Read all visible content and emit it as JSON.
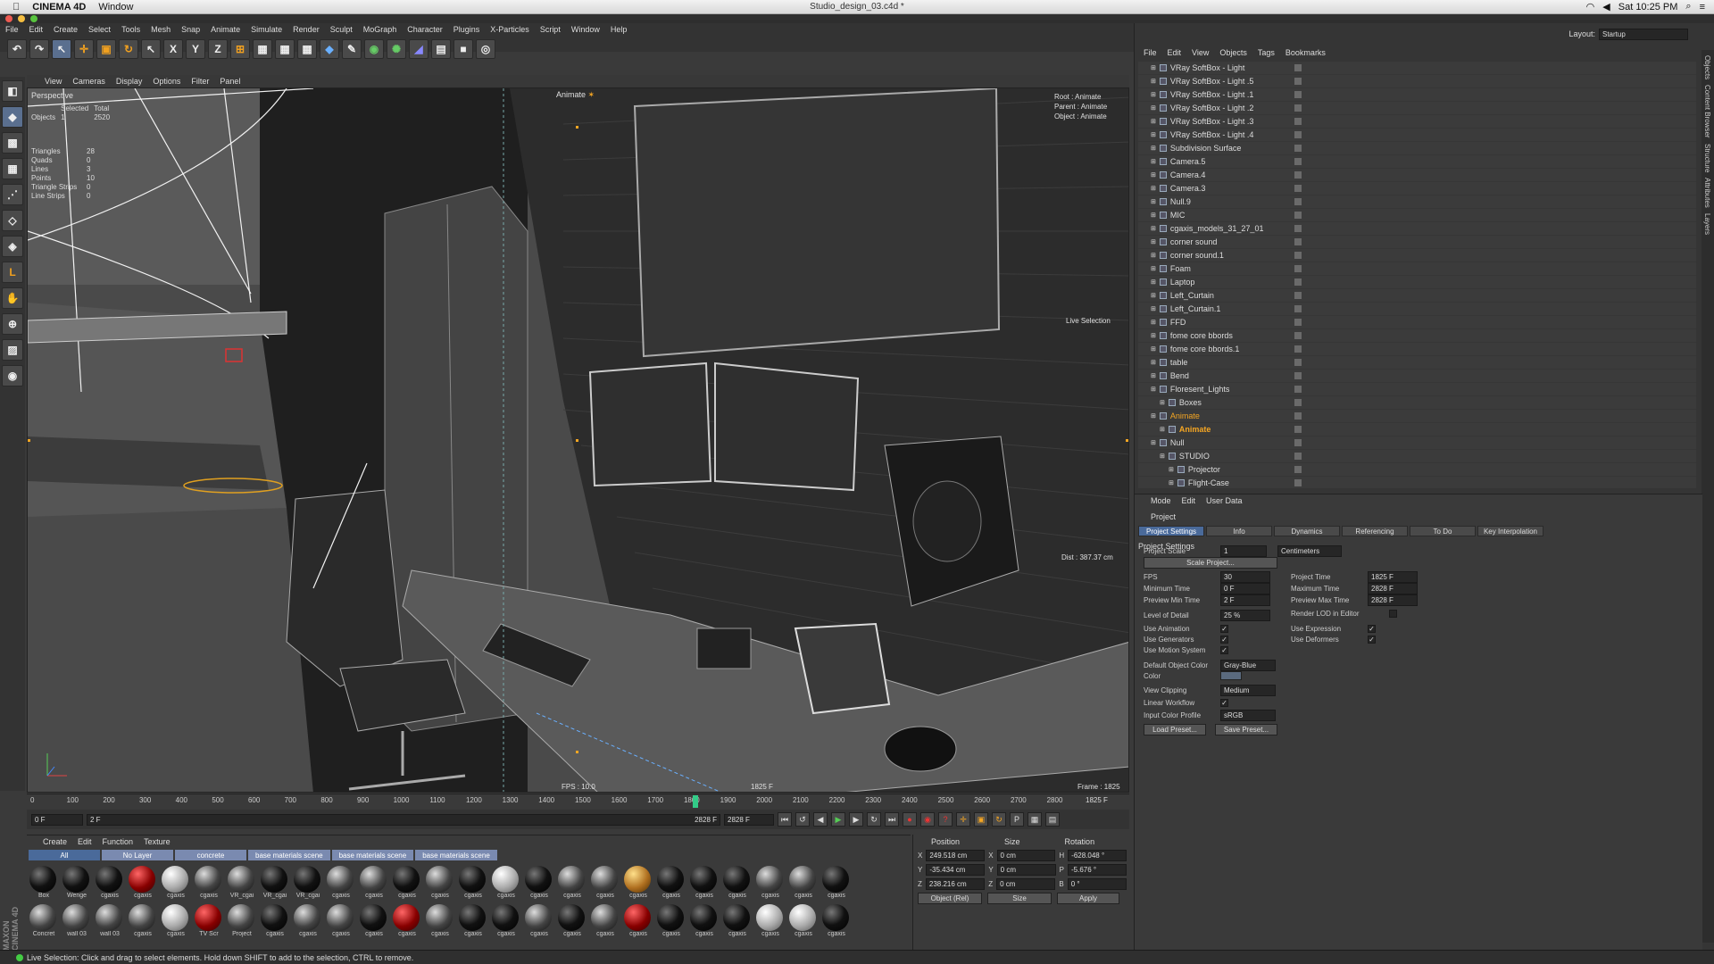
{
  "macbar": {
    "app": "CINEMA 4D",
    "menu": "Window",
    "title": "Studio_design_03.c4d *",
    "clock": "Sat 10:25 PM"
  },
  "menus": [
    "File",
    "Edit",
    "Create",
    "Select",
    "Tools",
    "Mesh",
    "Snap",
    "Animate",
    "Simulate",
    "Render",
    "Sculpt",
    "MoGraph",
    "Character",
    "Plugins",
    "X-Particles",
    "Script",
    "Window",
    "Help"
  ],
  "toolbar": {
    "x": "X",
    "y": "Y",
    "z": "Z"
  },
  "viewport": {
    "menus": [
      "View",
      "Cameras",
      "Display",
      "Options",
      "Filter",
      "Panel"
    ],
    "camera": "Perspective",
    "animate_label": "Animate",
    "stats_head": [
      "",
      "Selected",
      "Total"
    ],
    "stats_objects": [
      "Objects",
      "1",
      "2520"
    ],
    "stats": [
      [
        "Triangles",
        "28"
      ],
      [
        "Quads",
        "0"
      ],
      [
        "Lines",
        "3"
      ],
      [
        "Points",
        "10"
      ],
      [
        "Triangle Strips",
        "0"
      ],
      [
        "Line Strips",
        "0"
      ]
    ],
    "root": "Root : Animate",
    "parent": "Parent : Animate",
    "object": "Object : Animate",
    "live_selection": "Live Selection",
    "dist": "Dist : 387.37 cm",
    "fps": "FPS : 10.0",
    "frame_marker": "1825 F",
    "frame": "Frame : 1825"
  },
  "timeline": {
    "ticks": [
      "0",
      "100",
      "200",
      "300",
      "400",
      "500",
      "600",
      "700",
      "800",
      "900",
      "1000",
      "1100",
      "1200",
      "1300",
      "1400",
      "1500",
      "1600",
      "1700",
      "1800",
      "1900",
      "2000",
      "2100",
      "2200",
      "2300",
      "2400",
      "2500",
      "2600",
      "2700",
      "2800"
    ],
    "current": "1825",
    "current_field": "1825 F",
    "playhead_frame": 1825,
    "max_frame": 2828
  },
  "frames": {
    "start": "0 F",
    "preview_start": "2 F",
    "preview_end": "2828 F",
    "end": "2828 F"
  },
  "materials": {
    "menus": [
      "Create",
      "Edit",
      "Function",
      "Texture"
    ],
    "tabs": [
      "All",
      "No Layer",
      "concrete",
      "base materials scene",
      "base materials scene",
      "base materials scene"
    ],
    "row1": [
      {
        "n": "Box",
        "t": "dk"
      },
      {
        "n": "Wenge",
        "t": "dk"
      },
      {
        "n": "cgaxis",
        "t": "dk"
      },
      {
        "n": "cgaxis",
        "t": "red"
      },
      {
        "n": "cgaxis",
        "t": "wh"
      },
      {
        "n": "cgaxis",
        "t": ""
      },
      {
        "n": "VR_cgai",
        "t": ""
      },
      {
        "n": "VR_cgai",
        "t": "dk"
      },
      {
        "n": "VR_cgai",
        "t": "dk"
      },
      {
        "n": "cgaxis",
        "t": ""
      },
      {
        "n": "cgaxis",
        "t": ""
      },
      {
        "n": "cgaxis",
        "t": "dk"
      },
      {
        "n": "cgaxis",
        "t": ""
      },
      {
        "n": "cgaxis",
        "t": "dk"
      },
      {
        "n": "cgaxis",
        "t": "wh"
      },
      {
        "n": "cgaxis",
        "t": "dk"
      },
      {
        "n": "cgaxis",
        "t": ""
      },
      {
        "n": "cgaxis",
        "t": ""
      },
      {
        "n": "cgaxis",
        "t": "gold"
      },
      {
        "n": "cgaxis",
        "t": "dk"
      },
      {
        "n": "cgaxis",
        "t": "dk"
      },
      {
        "n": "cgaxis",
        "t": "dk"
      },
      {
        "n": "cgaxis",
        "t": ""
      },
      {
        "n": "cgaxis",
        "t": ""
      },
      {
        "n": "cgaxis",
        "t": "dk"
      }
    ],
    "row2": [
      {
        "n": "Concret",
        "t": ""
      },
      {
        "n": "wall 03",
        "t": ""
      },
      {
        "n": "wall 03",
        "t": ""
      },
      {
        "n": "cgaxis",
        "t": ""
      },
      {
        "n": "cgaxis",
        "t": "wh"
      },
      {
        "n": "TV Scr",
        "t": "red"
      },
      {
        "n": "Project",
        "t": ""
      },
      {
        "n": "cgaxis",
        "t": "dk"
      },
      {
        "n": "cgaxis",
        "t": ""
      },
      {
        "n": "cgaxis",
        "t": ""
      },
      {
        "n": "cgaxis",
        "t": "dk"
      },
      {
        "n": "cgaxis",
        "t": "red"
      },
      {
        "n": "cgaxis",
        "t": ""
      },
      {
        "n": "cgaxis",
        "t": "dk"
      },
      {
        "n": "cgaxis",
        "t": "dk"
      },
      {
        "n": "cgaxis",
        "t": ""
      },
      {
        "n": "cgaxis",
        "t": "dk"
      },
      {
        "n": "cgaxis",
        "t": ""
      },
      {
        "n": "cgaxis",
        "t": "red"
      },
      {
        "n": "cgaxis",
        "t": "dk"
      },
      {
        "n": "cgaxis",
        "t": "dk"
      },
      {
        "n": "cgaxis",
        "t": "dk"
      },
      {
        "n": "cgaxis",
        "t": "wh"
      },
      {
        "n": "cgaxis",
        "t": "wh"
      },
      {
        "n": "cgaxis",
        "t": "dk"
      }
    ]
  },
  "coords": {
    "headers": [
      "Position",
      "Size",
      "Rotation"
    ],
    "rows": [
      [
        "X",
        "249.518 cm",
        "X",
        "0 cm",
        "H",
        "-628.048 °"
      ],
      [
        "Y",
        "-35.434 cm",
        "Y",
        "0 cm",
        "P",
        "-5.676 °"
      ],
      [
        "Z",
        "238.216 cm",
        "Z",
        "0 cm",
        "B",
        "0 °"
      ]
    ],
    "mode": "Object (Rel)",
    "size_mode": "Size",
    "apply": "Apply"
  },
  "status": "Live Selection: Click and drag to select elements. Hold down SHIFT to add to the selection, CTRL to remove.",
  "maxon": "MAXON CINEMA 4D",
  "layout": {
    "label": "Layout:",
    "value": "Startup"
  },
  "objmenu": [
    "File",
    "Edit",
    "View",
    "Objects",
    "Tags",
    "Bookmarks"
  ],
  "objects": [
    {
      "n": "VRay SoftBox - Light",
      "i": 1,
      "s": ""
    },
    {
      "n": "VRay SoftBox - Light .5",
      "i": 1,
      "s": ""
    },
    {
      "n": "VRay SoftBox - Light .1",
      "i": 1,
      "s": ""
    },
    {
      "n": "VRay SoftBox - Light .2",
      "i": 1,
      "s": ""
    },
    {
      "n": "VRay SoftBox - Light .3",
      "i": 1,
      "s": ""
    },
    {
      "n": "VRay SoftBox - Light .4",
      "i": 1,
      "s": ""
    },
    {
      "n": "Subdivision Surface",
      "i": 1,
      "s": ""
    },
    {
      "n": "Camera.5",
      "i": 1,
      "s": ""
    },
    {
      "n": "Camera.4",
      "i": 1,
      "s": ""
    },
    {
      "n": "Camera.3",
      "i": 1,
      "s": ""
    },
    {
      "n": "Null.9",
      "i": 1,
      "s": ""
    },
    {
      "n": "MIC",
      "i": 1,
      "s": ""
    },
    {
      "n": "cgaxis_models_31_27_01",
      "i": 1,
      "s": ""
    },
    {
      "n": "corner sound",
      "i": 1,
      "s": ""
    },
    {
      "n": "corner sound.1",
      "i": 1,
      "s": ""
    },
    {
      "n": "Foam",
      "i": 1,
      "s": ""
    },
    {
      "n": "Laptop",
      "i": 1,
      "s": ""
    },
    {
      "n": "Left_Curtain",
      "i": 1,
      "s": ""
    },
    {
      "n": "Left_Curtain.1",
      "i": 1,
      "s": ""
    },
    {
      "n": "FFD",
      "i": 1,
      "s": ""
    },
    {
      "n": "fome core bbords",
      "i": 1,
      "s": ""
    },
    {
      "n": "fome core bbords.1",
      "i": 1,
      "s": ""
    },
    {
      "n": "table",
      "i": 1,
      "s": ""
    },
    {
      "n": "Bend",
      "i": 1,
      "s": ""
    },
    {
      "n": "Floresent_Lights",
      "i": 1,
      "s": ""
    },
    {
      "n": "Boxes",
      "i": 2,
      "s": ""
    },
    {
      "n": "Animate",
      "i": 1,
      "s": "hl"
    },
    {
      "n": "Animate",
      "i": 2,
      "s": "hlb"
    },
    {
      "n": "Null",
      "i": 1,
      "s": ""
    },
    {
      "n": "STUDIO",
      "i": 2,
      "s": ""
    },
    {
      "n": "Projector",
      "i": 3,
      "s": ""
    },
    {
      "n": "Flight-Case",
      "i": 3,
      "s": ""
    }
  ],
  "sidetabs": [
    "Objects",
    "Content Browser",
    "Structure",
    "Attributes",
    "Layers"
  ],
  "attr": {
    "menus": [
      "Mode",
      "Edit",
      "User Data"
    ],
    "title": "Project",
    "tabs": [
      "Project Settings",
      "Info",
      "Dynamics",
      "Referencing",
      "To Do",
      "Key Interpolation"
    ],
    "section": "Project Settings",
    "project_scale": "Project Scale",
    "scale_value": "1",
    "scale_unit": "Centimeters",
    "scale_button": "Scale Project...",
    "fps_label": "FPS",
    "fps": "30",
    "project_time_label": "Project Time",
    "project_time": "1825 F",
    "min_time_label": "Minimum Time",
    "min_time": "0 F",
    "max_time_label": "Maximum Time",
    "max_time": "2828 F",
    "pmin_label": "Preview Min Time",
    "pmin": "2 F",
    "pmax_label": "Preview Max Time",
    "pmax": "2828 F",
    "lod_label": "Level of Detail",
    "lod": "25 %",
    "render_lod": "Render LOD in Editor",
    "use_anim": "Use Animation",
    "use_expr": "Use Expression",
    "use_gen": "Use Generators",
    "use_def": "Use Deformers",
    "use_motion": "Use Motion System",
    "def_color_label": "Default Object Color",
    "def_color": "Gray-Blue",
    "color_label": "Color",
    "clip_label": "View Clipping",
    "clip": "Medium",
    "linear": "Linear Workflow",
    "icp_label": "Input Color Profile",
    "icp": "sRGB",
    "load_preset": "Load Preset...",
    "save_preset": "Save Preset...",
    "check": "✓"
  }
}
